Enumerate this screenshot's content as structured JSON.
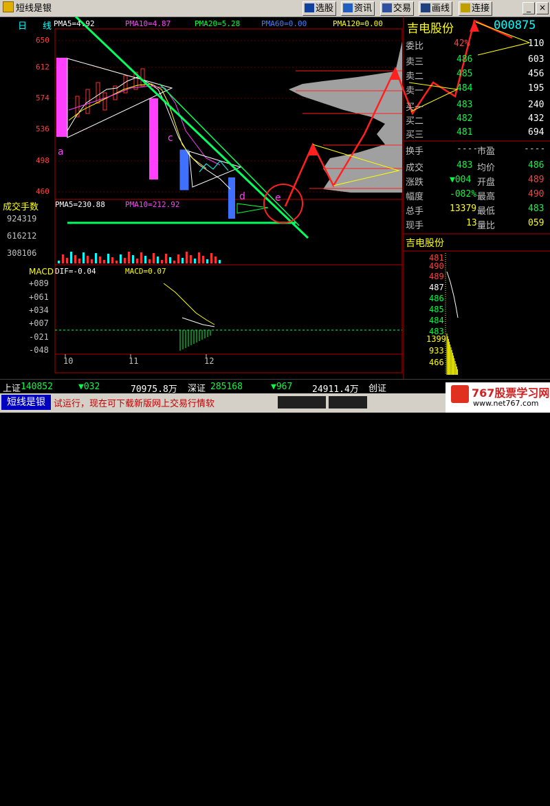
{
  "app": {
    "title": "短线是银"
  },
  "toolbar": {
    "buttons": [
      "选股",
      "资讯",
      "交易",
      "画线",
      "连接"
    ]
  },
  "window": {
    "minimize": "_",
    "close": "×"
  },
  "chart_header": {
    "period": "日",
    "period2": "线",
    "ma5": "PMA5=4.92",
    "ma10": "PMA10=4.87",
    "ma20": "PMA20=5.28",
    "ma60": "PMA60=0.00",
    "ma120": "PMA120=0.00"
  },
  "price_axis": [
    "650",
    "612",
    "574",
    "536",
    "498",
    "460"
  ],
  "annotations": {
    "a": "a",
    "c": "c",
    "d": "d",
    "e": "e"
  },
  "volume": {
    "title": "成交手数",
    "ma5": "PMA5=230.88",
    "ma10": "PMA10=212.92",
    "axis": [
      "924319",
      "616212",
      "308106"
    ]
  },
  "macd": {
    "title": "MACD",
    "dif": "DIF=-0.04",
    "macd": "MACD=0.07",
    "axis": [
      "+089",
      "+061",
      "+034",
      "+007",
      "-021",
      "-048"
    ]
  },
  "x_axis": [
    "10",
    "11",
    "12"
  ],
  "stock": {
    "name": "吉电股份",
    "code": "000875"
  },
  "orderbook": {
    "weibi": {
      "label": "委比",
      "pct": "42%",
      "vol": "110"
    },
    "asks": [
      {
        "label": "卖三",
        "price": "486",
        "vol": "603"
      },
      {
        "label": "卖二",
        "price": "485",
        "vol": "456"
      },
      {
        "label": "卖一",
        "price": "484",
        "vol": "195"
      }
    ],
    "bids": [
      {
        "label": "买一",
        "price": "483",
        "vol": "240"
      },
      {
        "label": "买二",
        "price": "482",
        "vol": "432"
      },
      {
        "label": "买三",
        "price": "481",
        "vol": "694"
      }
    ]
  },
  "quote": {
    "turnover_label": "换手",
    "turnover_val": "----",
    "pe_label": "市盈",
    "pe_val": "----",
    "rows": [
      {
        "l1": "成交",
        "v1": "483",
        "l2": "均价",
        "v2": "486"
      },
      {
        "l1": "涨跌",
        "v1": "▼004",
        "l2": "开盘",
        "v2": "489"
      },
      {
        "l1": "幅度",
        "v1": "-082%",
        "l2": "最高",
        "v2": "490"
      },
      {
        "l1": "总手",
        "v1": "13379",
        "l2": "最低",
        "v2": "483"
      },
      {
        "l1": "现手",
        "v1": "13",
        "l2": "量比",
        "v2": "059"
      }
    ]
  },
  "mini": {
    "title": "吉电股份",
    "prices": [
      "481",
      "490",
      "489",
      "487",
      "486",
      "485",
      "484",
      "483"
    ],
    "vols": [
      "1399",
      "933",
      "466"
    ]
  },
  "status": {
    "sh_label": "上证",
    "sh_val": "140852",
    "sh_chg": "▼032",
    "sh_amt": "70975.8万",
    "sz_label": "深证",
    "sz_val": "285168",
    "sz_chg": "▼967",
    "sz_amt": "24911.4万",
    "sz_tail": "创证"
  },
  "footer": {
    "app": "短线是银",
    "marquee": "试运行，现在可下载新版网上交易行情软",
    "watermark": "767股票学习网",
    "url": "www.net767.com"
  },
  "colors": {
    "up": "#ff3030",
    "down": "#00ffff",
    "ma5": "#ffffff",
    "ma10": "#ffff00",
    "ma20": "#ff00ff",
    "trend": "#00ff40"
  }
}
